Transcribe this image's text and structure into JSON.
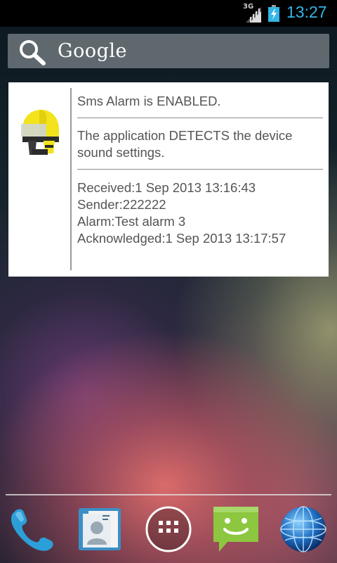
{
  "status_bar": {
    "network": "3G",
    "time": "13:27",
    "icons": [
      "signal-icon",
      "battery-charging-icon"
    ]
  },
  "search": {
    "label": "Google",
    "icon": "search-icon"
  },
  "widget": {
    "icon": "firefighter-helmet-icon",
    "status_text": "Sms Alarm is ENABLED.",
    "detect_text_line1": "The application DETECTS the device",
    "detect_text_line2": "sound settings.",
    "received": "Received:1 Sep 2013 13:16:43",
    "sender": "Sender:222222",
    "alarm": "Alarm:Test alarm 3",
    "acknowledged": "Acknowledged:1 Sep 2013 13:17:57"
  },
  "dock": {
    "items": [
      {
        "icon": "phone-icon"
      },
      {
        "icon": "contacts-icon"
      },
      {
        "icon": "app-drawer-icon"
      },
      {
        "icon": "messaging-icon"
      },
      {
        "icon": "browser-icon"
      }
    ]
  },
  "colors": {
    "clock": "#33b5e5",
    "widget_text": "#555555",
    "widget_background": "#ffffff"
  }
}
